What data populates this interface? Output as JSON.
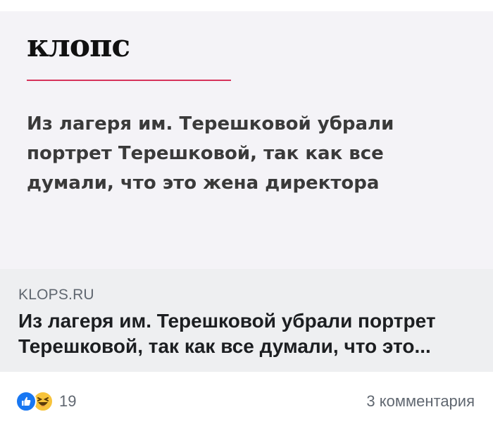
{
  "preview": {
    "logo": "клопс",
    "headline": "Из лагеря им. Терешковой убрали портрет Терешковой, так как все думали, что это жена директора",
    "accent_color": "#d6335a"
  },
  "link": {
    "domain": "KLOPS.RU",
    "title": "Из лагеря им. Терешковой убрали портрет Терешковой, так как все думали, что это..."
  },
  "footer": {
    "reaction_icons": [
      "like-icon",
      "haha-icon"
    ],
    "reaction_count": "19",
    "comments_label": "3 комментария"
  }
}
